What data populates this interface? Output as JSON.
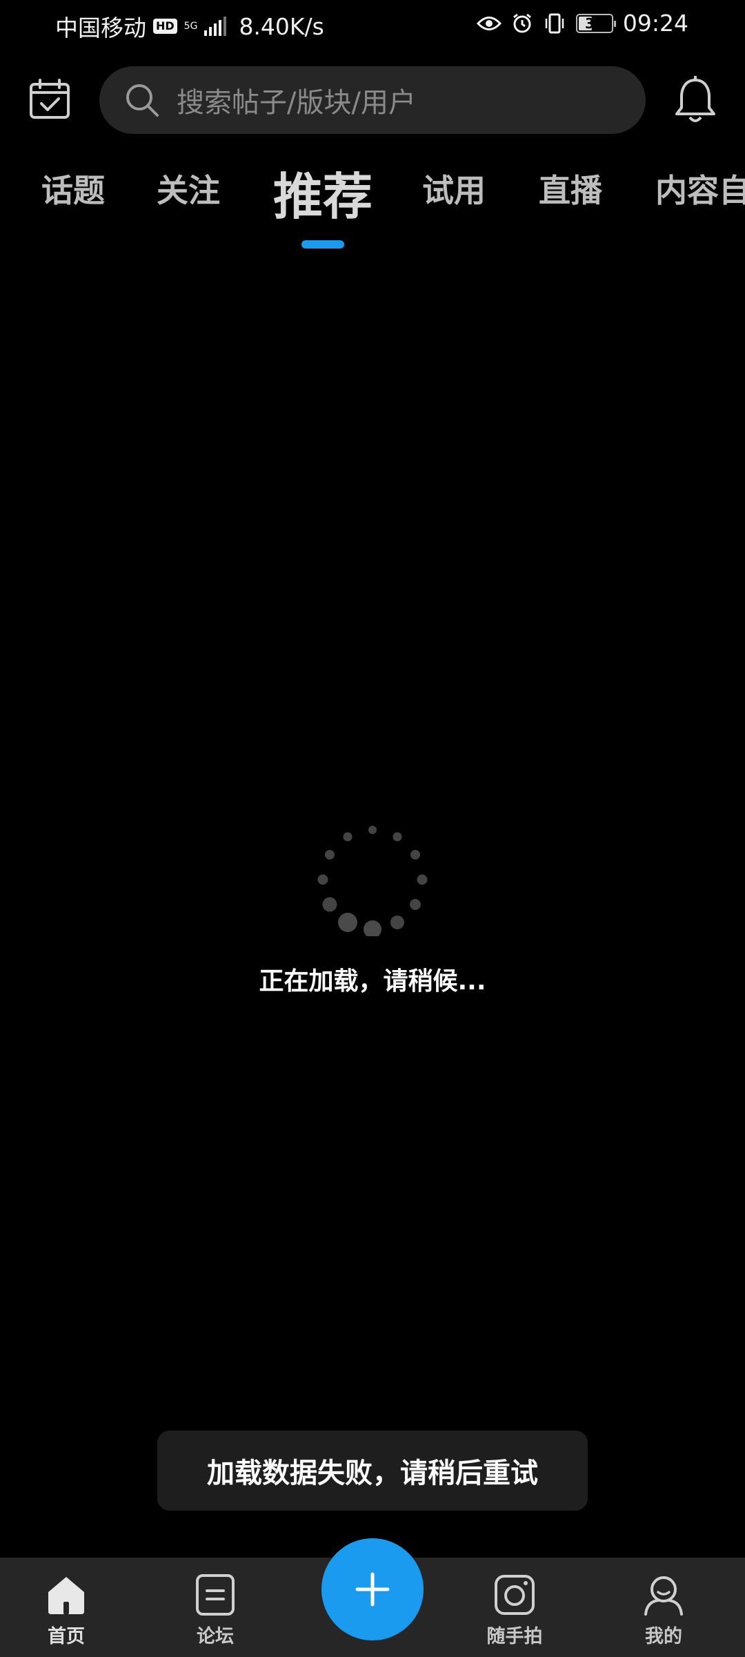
{
  "status_bar": {
    "carrier": "中国移动",
    "hd_badge": "HD",
    "network_type": "5G",
    "net_speed": "8.40K/s",
    "battery_level": "38",
    "time": "09:24",
    "icons": [
      "eye-icon",
      "alarm-icon",
      "vibrate-icon",
      "battery-icon"
    ]
  },
  "header": {
    "calendar_icon": "calendar-check-icon",
    "search_placeholder": "搜索帖子/版块/用户",
    "bell_icon": "bell-icon"
  },
  "tabs": [
    {
      "label": "话题",
      "active": false
    },
    {
      "label": "关注",
      "active": false
    },
    {
      "label": "推荐",
      "active": true
    },
    {
      "label": "试用",
      "active": false
    },
    {
      "label": "直播",
      "active": false
    },
    {
      "label": "内容自",
      "active": false
    }
  ],
  "loading": {
    "text": "正在加载，请稍候..."
  },
  "toast": {
    "text": "加载数据失败，请稍后重试"
  },
  "bottom_nav": {
    "items": [
      {
        "label": "首页",
        "icon": "home-icon",
        "active": true
      },
      {
        "label": "论坛",
        "icon": "forum-icon",
        "active": false
      },
      {
        "label": "随手拍",
        "icon": "camera-icon",
        "active": false
      },
      {
        "label": "我的",
        "icon": "profile-icon",
        "active": false
      }
    ],
    "fab_icon": "plus-icon"
  },
  "colors": {
    "accent": "#1a9bf0",
    "background": "#000000",
    "surface": "#262626"
  }
}
